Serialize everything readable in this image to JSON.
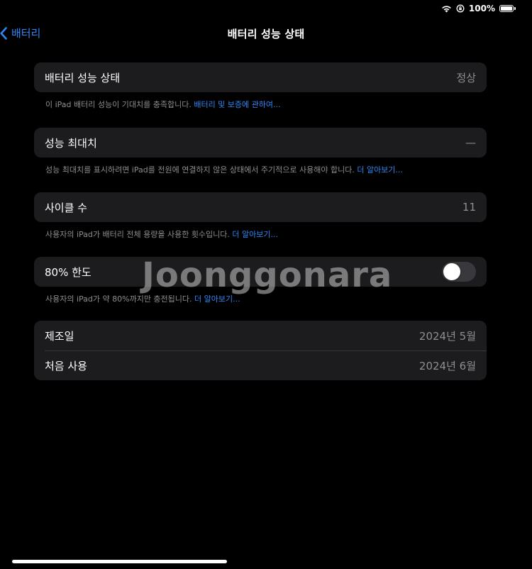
{
  "status_bar": {
    "battery_text": "100%",
    "battery_level": 1.0
  },
  "nav": {
    "back_label": "배터리",
    "title": "배터리 성능 상태"
  },
  "sections": {
    "health": {
      "label": "배터리 성능 상태",
      "value": "정상",
      "footnote_text": "이 iPad 배터리 성능이 기대치를 충족합니다. ",
      "footnote_link": "배터리 및 보증에 관하여..."
    },
    "max_capacity": {
      "label": "성능 최대치",
      "value": "—",
      "footnote_text": "성능 최대치를 표시하려면 iPad를 전원에 연결하지 않은 상태에서 주기적으로 사용해야 합니다. ",
      "footnote_link": "더 알아보기..."
    },
    "cycle_count": {
      "label": "사이클 수",
      "value": "11",
      "footnote_text": "사용자의 iPad가 배터리 전체 용량을 사용한 횟수입니다. ",
      "footnote_link": "더 알아보기..."
    },
    "limit_80": {
      "label": "80% 한도",
      "toggle_on": false,
      "footnote_text": "사용자의 iPad가 약 80%까지만 충전됩니다. ",
      "footnote_link": "더 알아보기..."
    },
    "dates": {
      "manufacture_label": "제조일",
      "manufacture_value": "2024년 5월",
      "first_use_label": "처음 사용",
      "first_use_value": "2024년 6월"
    }
  },
  "watermark": "Joonggonara",
  "icons": {
    "wifi": "wifi-icon",
    "orientation_lock": "orientation-lock-icon",
    "battery": "battery-icon",
    "back": "chevron-left-icon"
  },
  "colors": {
    "background": "#000000",
    "cell": "#1c1c1e",
    "accent": "#2f86f6",
    "secondary_text": "#8e8e93",
    "toggle_off": "#39393d"
  }
}
